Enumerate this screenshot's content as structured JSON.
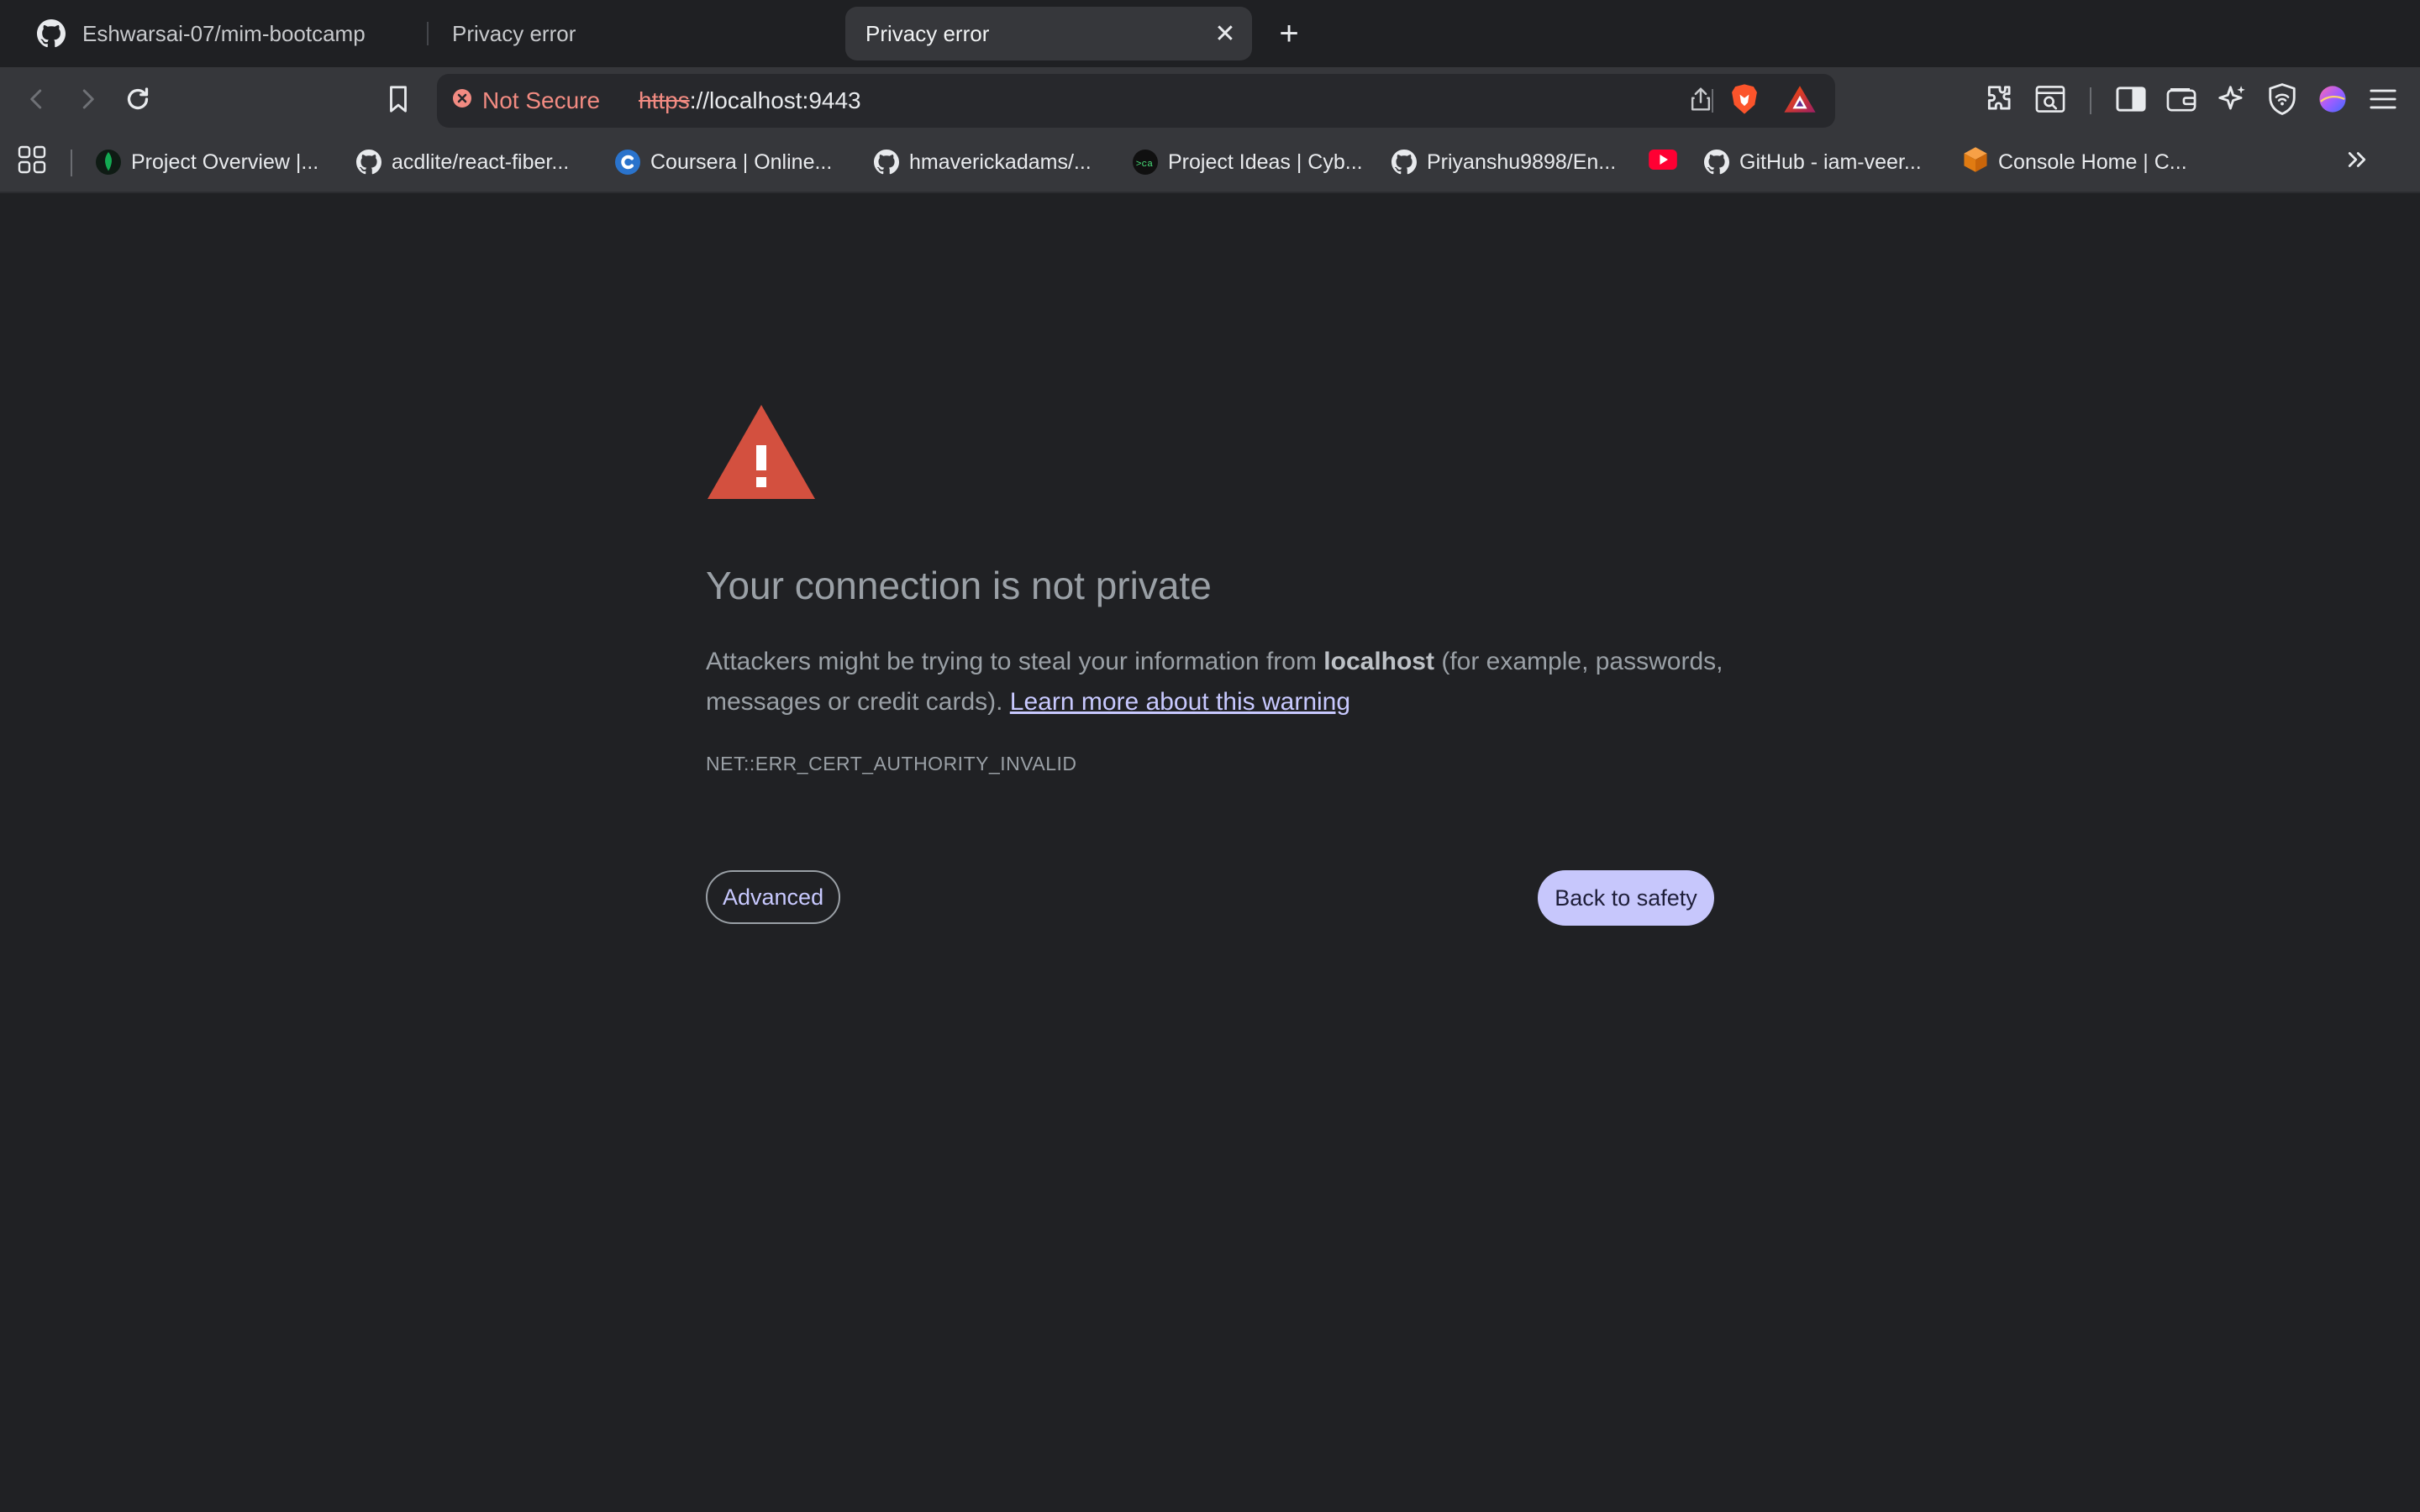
{
  "tabs": [
    {
      "label": "Eshwarsai-07/mim-bootcamp",
      "icon": "github-icon"
    },
    {
      "label": "Privacy error"
    },
    {
      "label": "Privacy error",
      "active": true
    }
  ],
  "new_tab_symbol": "+",
  "close_symbol": "✕",
  "omnibox": {
    "security_label": "Not Secure",
    "scheme": "https",
    "host": "://localhost:9443"
  },
  "bookmarks": [
    {
      "label": "Project Overview |...",
      "icon": "mongodb-leaf-icon"
    },
    {
      "label": "acdlite/react-fiber...",
      "icon": "github-icon"
    },
    {
      "label": "Coursera | Online...",
      "icon": "coursera-icon"
    },
    {
      "label": "hmaverickadams/...",
      "icon": "github-icon"
    },
    {
      "label": "Project Ideas | Cyb...",
      "icon": "cyberacademy-icon"
    },
    {
      "label": "Priyanshu9898/En...",
      "icon": "github-icon"
    },
    {
      "label": "",
      "icon": "youtube-icon"
    },
    {
      "label": "GitHub - iam-veer...",
      "icon": "github-icon"
    },
    {
      "label": "Console Home | C...",
      "icon": "aws-cube-icon"
    }
  ],
  "page": {
    "heading": "Your connection is not private",
    "para_before": "Attackers might be trying to steal your information from ",
    "para_host": "localhost",
    "para_after": " (for example, passwords, messages or credit cards). ",
    "learn_more": "Learn more about this warning",
    "error_code": "NET::ERR_CERT_AUTHORITY_INVALID",
    "advanced_label": "Advanced",
    "back_label": "Back to safety"
  },
  "colors": {
    "background": "#202124",
    "warning_red": "#d3503f",
    "not_secure": "#f28b82",
    "primary_button": "#c7c7fc"
  }
}
